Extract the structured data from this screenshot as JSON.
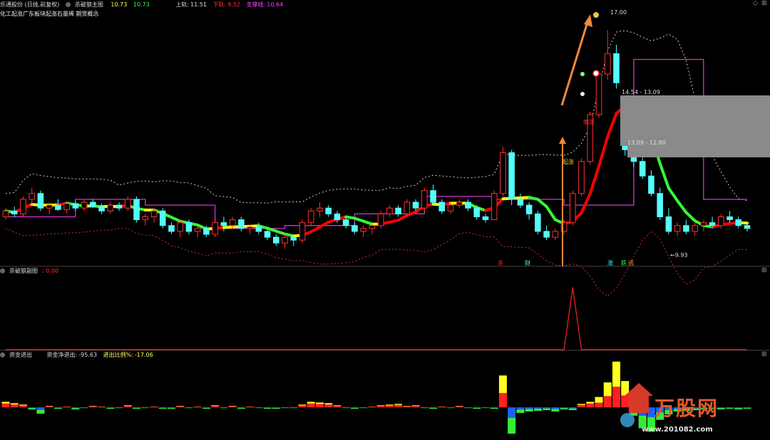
{
  "header_main": {
    "stock": "乐通股份 (日线,前复权)",
    "indicator": "杀破狼主图",
    "val1": "10.73",
    "val2": "10.73",
    "upper_label": "上轨:",
    "upper_val": "11.51",
    "lower_label": "下轨:",
    "lower_val": "9.52",
    "zhicheng_label": "支撑线:",
    "zhicheng_val": "10.64",
    "concepts": "化工起涨广东板块起涨石墨烯 期货概念"
  },
  "header_sub1": {
    "name": "杀破狼副图",
    "value": ": 0.00"
  },
  "header_sub2": {
    "name": "资金进出",
    "net_label": "资金净进出:",
    "net_val": "-95.63",
    "ratio_label": "进出比例%:",
    "ratio_val": "-17.06"
  },
  "annotations": {
    "high": "17.00",
    "low": "←9.93",
    "box_top": "14.54 - 13.09",
    "box_bottom": "13.09 - 12.80",
    "qizhang": "起涨",
    "jiazhang": "加涨",
    "sig_sha": "杀",
    "sig_cai": "财",
    "sig_zhang": "涨",
    "sig_die": "跌",
    "sig_tao": "逃"
  },
  "watermark": {
    "brand": "万股网",
    "url": "www.201082.com"
  },
  "colors": {
    "up": "#ff3232",
    "down": "#54fcfc",
    "upper_band": "#cccccc",
    "lower_band": "#c83232",
    "support": "#d833d8",
    "trend_up": "#ff0000",
    "trend_down": "#33ff33",
    "trend_mid": "#ffff00"
  },
  "chart_data": {
    "type": "candlestick",
    "ylim": [
      9.0,
      17.6
    ],
    "candles": [
      [
        10.6,
        10.9,
        10.5,
        10.8
      ],
      [
        10.8,
        10.95,
        10.6,
        10.7
      ],
      [
        10.7,
        11.3,
        10.6,
        11.2
      ],
      [
        11.2,
        11.6,
        11.0,
        11.4
      ],
      [
        11.4,
        11.5,
        10.8,
        10.9
      ],
      [
        10.9,
        11.1,
        10.7,
        11.0
      ],
      [
        11.0,
        11.2,
        10.8,
        10.85
      ],
      [
        10.85,
        11.1,
        10.7,
        11.05
      ],
      [
        11.05,
        11.15,
        10.8,
        10.9
      ],
      [
        10.9,
        11.2,
        10.8,
        11.1
      ],
      [
        11.1,
        11.2,
        10.9,
        10.95
      ],
      [
        10.95,
        11.05,
        10.7,
        10.8
      ],
      [
        10.8,
        11.1,
        10.7,
        11.0
      ],
      [
        11.0,
        11.1,
        10.8,
        10.9
      ],
      [
        10.9,
        11.3,
        10.8,
        11.2
      ],
      [
        11.2,
        11.3,
        10.4,
        10.5
      ],
      [
        10.5,
        10.7,
        10.3,
        10.6
      ],
      [
        10.6,
        10.9,
        10.4,
        10.8
      ],
      [
        10.8,
        10.9,
        10.2,
        10.3
      ],
      [
        10.3,
        10.4,
        10.0,
        10.1
      ],
      [
        10.1,
        10.5,
        9.9,
        10.4
      ],
      [
        10.4,
        10.5,
        10.0,
        10.1
      ],
      [
        10.1,
        10.3,
        9.9,
        10.2
      ],
      [
        10.2,
        10.3,
        9.9,
        10.0
      ],
      [
        10.0,
        10.5,
        9.9,
        10.4
      ],
      [
        10.4,
        10.6,
        10.1,
        10.3
      ],
      [
        10.3,
        10.6,
        10.2,
        10.5
      ],
      [
        10.5,
        10.6,
        10.1,
        10.2
      ],
      [
        10.2,
        10.3,
        10.0,
        10.25
      ],
      [
        10.25,
        10.4,
        10.0,
        10.1
      ],
      [
        10.1,
        10.2,
        9.8,
        9.9
      ],
      [
        9.9,
        10.0,
        9.6,
        9.7
      ],
      [
        9.7,
        10.0,
        9.5,
        9.9
      ],
      [
        9.9,
        10.0,
        9.6,
        9.8
      ],
      [
        9.8,
        10.5,
        9.7,
        10.4
      ],
      [
        10.4,
        10.9,
        10.3,
        10.8
      ],
      [
        10.8,
        11.1,
        10.6,
        10.9
      ],
      [
        10.9,
        11.0,
        10.6,
        10.7
      ],
      [
        10.7,
        10.8,
        10.4,
        10.5
      ],
      [
        10.5,
        10.6,
        10.2,
        10.3
      ],
      [
        10.3,
        10.4,
        10.0,
        10.1
      ],
      [
        10.1,
        10.3,
        9.9,
        10.2
      ],
      [
        10.2,
        10.4,
        10.0,
        10.3
      ],
      [
        10.3,
        10.8,
        10.2,
        10.7
      ],
      [
        10.7,
        11.0,
        10.6,
        10.9
      ],
      [
        10.9,
        11.0,
        10.6,
        10.7
      ],
      [
        10.7,
        11.2,
        10.6,
        11.1
      ],
      [
        11.1,
        11.2,
        10.8,
        10.9
      ],
      [
        10.9,
        11.6,
        10.8,
        11.5
      ],
      [
        11.5,
        11.7,
        11.0,
        11.1
      ],
      [
        11.1,
        11.2,
        10.7,
        10.8
      ],
      [
        10.8,
        11.1,
        10.7,
        11.0
      ],
      [
        11.0,
        11.2,
        10.9,
        11.1
      ],
      [
        11.1,
        11.2,
        10.8,
        10.9
      ],
      [
        10.9,
        11.0,
        10.5,
        10.6
      ],
      [
        10.6,
        10.7,
        10.4,
        10.5
      ],
      [
        10.5,
        11.5,
        10.5,
        11.4
      ],
      [
        11.4,
        13.0,
        11.3,
        12.8
      ],
      [
        12.8,
        12.9,
        11.0,
        11.2
      ],
      [
        11.2,
        11.4,
        10.9,
        11.0
      ],
      [
        11.0,
        11.1,
        10.5,
        10.7
      ],
      [
        10.7,
        10.8,
        10.0,
        10.1
      ],
      [
        10.1,
        10.3,
        9.8,
        9.9
      ],
      [
        9.9,
        10.2,
        9.8,
        10.1
      ],
      [
        10.1,
        10.5,
        10.0,
        10.4
      ],
      [
        10.4,
        11.5,
        10.3,
        11.4
      ],
      [
        11.4,
        12.6,
        11.3,
        12.5
      ],
      [
        12.5,
        14.2,
        12.4,
        14.1
      ],
      [
        14.1,
        15.6,
        14.0,
        15.5
      ],
      [
        15.5,
        17.0,
        15.3,
        16.2
      ],
      [
        16.2,
        16.5,
        15.0,
        15.2
      ],
      [
        13.4,
        13.8,
        12.7,
        12.9
      ],
      [
        12.9,
        13.2,
        12.3,
        12.5
      ],
      [
        12.5,
        12.7,
        11.9,
        12.0
      ],
      [
        12.0,
        12.2,
        11.3,
        11.4
      ],
      [
        11.4,
        11.6,
        10.5,
        10.6
      ],
      [
        10.6,
        10.9,
        10.0,
        10.1
      ],
      [
        10.1,
        10.4,
        9.93,
        10.3
      ],
      [
        10.3,
        10.5,
        10.0,
        10.1
      ],
      [
        10.1,
        10.4,
        9.95,
        10.3
      ],
      [
        10.3,
        10.5,
        10.1,
        10.4
      ],
      [
        10.4,
        10.6,
        10.2,
        10.3
      ],
      [
        10.3,
        10.7,
        10.2,
        10.6
      ],
      [
        10.6,
        10.8,
        10.4,
        10.5
      ],
      [
        10.5,
        10.6,
        10.2,
        10.3
      ],
      [
        10.3,
        10.4,
        10.1,
        10.2
      ]
    ],
    "sub1": {
      "ylim": [
        0,
        1.2
      ],
      "spike_index": 65,
      "spike_value": 1.0
    },
    "sub2": {
      "ylim": [
        -45,
        70
      ],
      "values": [
        8,
        6,
        4,
        -3,
        -9,
        2,
        -2,
        1,
        -3,
        -1,
        2,
        1,
        -2,
        -1,
        3,
        -2,
        -1,
        1,
        -2,
        -2,
        2,
        -1,
        1,
        -2,
        3,
        -1,
        2,
        -2,
        1,
        -1,
        -2,
        -2,
        -1,
        -1,
        4,
        8,
        7,
        6,
        3,
        -1,
        -2,
        -1,
        1,
        3,
        4,
        5,
        2,
        3,
        -1,
        -2,
        1,
        -1,
        2,
        -1,
        -2,
        -1,
        -2,
        46,
        -38,
        -8,
        -6,
        -5,
        -4,
        -6,
        -3,
        -4,
        5,
        8,
        15,
        36,
        66,
        38,
        -12,
        -30,
        -35,
        -18,
        -10,
        -6,
        -5,
        -4,
        -3,
        -2,
        -3,
        -2,
        -3,
        -2
      ]
    }
  }
}
